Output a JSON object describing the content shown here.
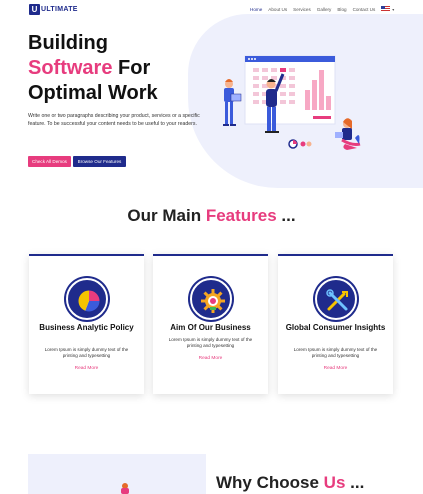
{
  "header": {
    "logo_letter": "U",
    "logo_text": "ULTIMATE",
    "nav": [
      "Home",
      "About Us",
      "Services",
      "Gallery",
      "Blog",
      "Contact Us"
    ],
    "language_flag": "us-flag-icon"
  },
  "hero": {
    "title_line1": "Building",
    "title_line2_accent": "Software",
    "title_line2_rest": " For",
    "title_line3": "Optimal Work",
    "description": "Write one or two paragraphs describing your product, services or a specific feature.  To be successful your content needs to be useful to your readers.",
    "primary_button": "Check All Demos",
    "secondary_button": "Browse Our Features"
  },
  "features": {
    "title_main": "Our Main ",
    "title_accent": "Features",
    "title_tail": " ...",
    "cards": [
      {
        "icon": "pie-chart-icon",
        "title": "Business Analytic Policy",
        "text": "Lorem Ipsum is simply dummy text of the printing and typesetting",
        "link": "Read More"
      },
      {
        "icon": "gear-icon",
        "title": "Aim Of Our Business",
        "text": "Lorem Ipsum is simply dummy text of the printing and typesetting",
        "link": "Read More"
      },
      {
        "icon": "tools-icon",
        "title": "Global Consumer Insights",
        "text": "Lorem Ipsum is simply dummy text of the printing and typesetting",
        "link": "Read More"
      }
    ]
  },
  "why": {
    "title_main": "Why Choose ",
    "title_accent": "Us",
    "title_tail": " ..."
  },
  "colors": {
    "primary": "#1f2b8c",
    "accent": "#e73c7e",
    "hero_bg": "#eef0fc"
  }
}
